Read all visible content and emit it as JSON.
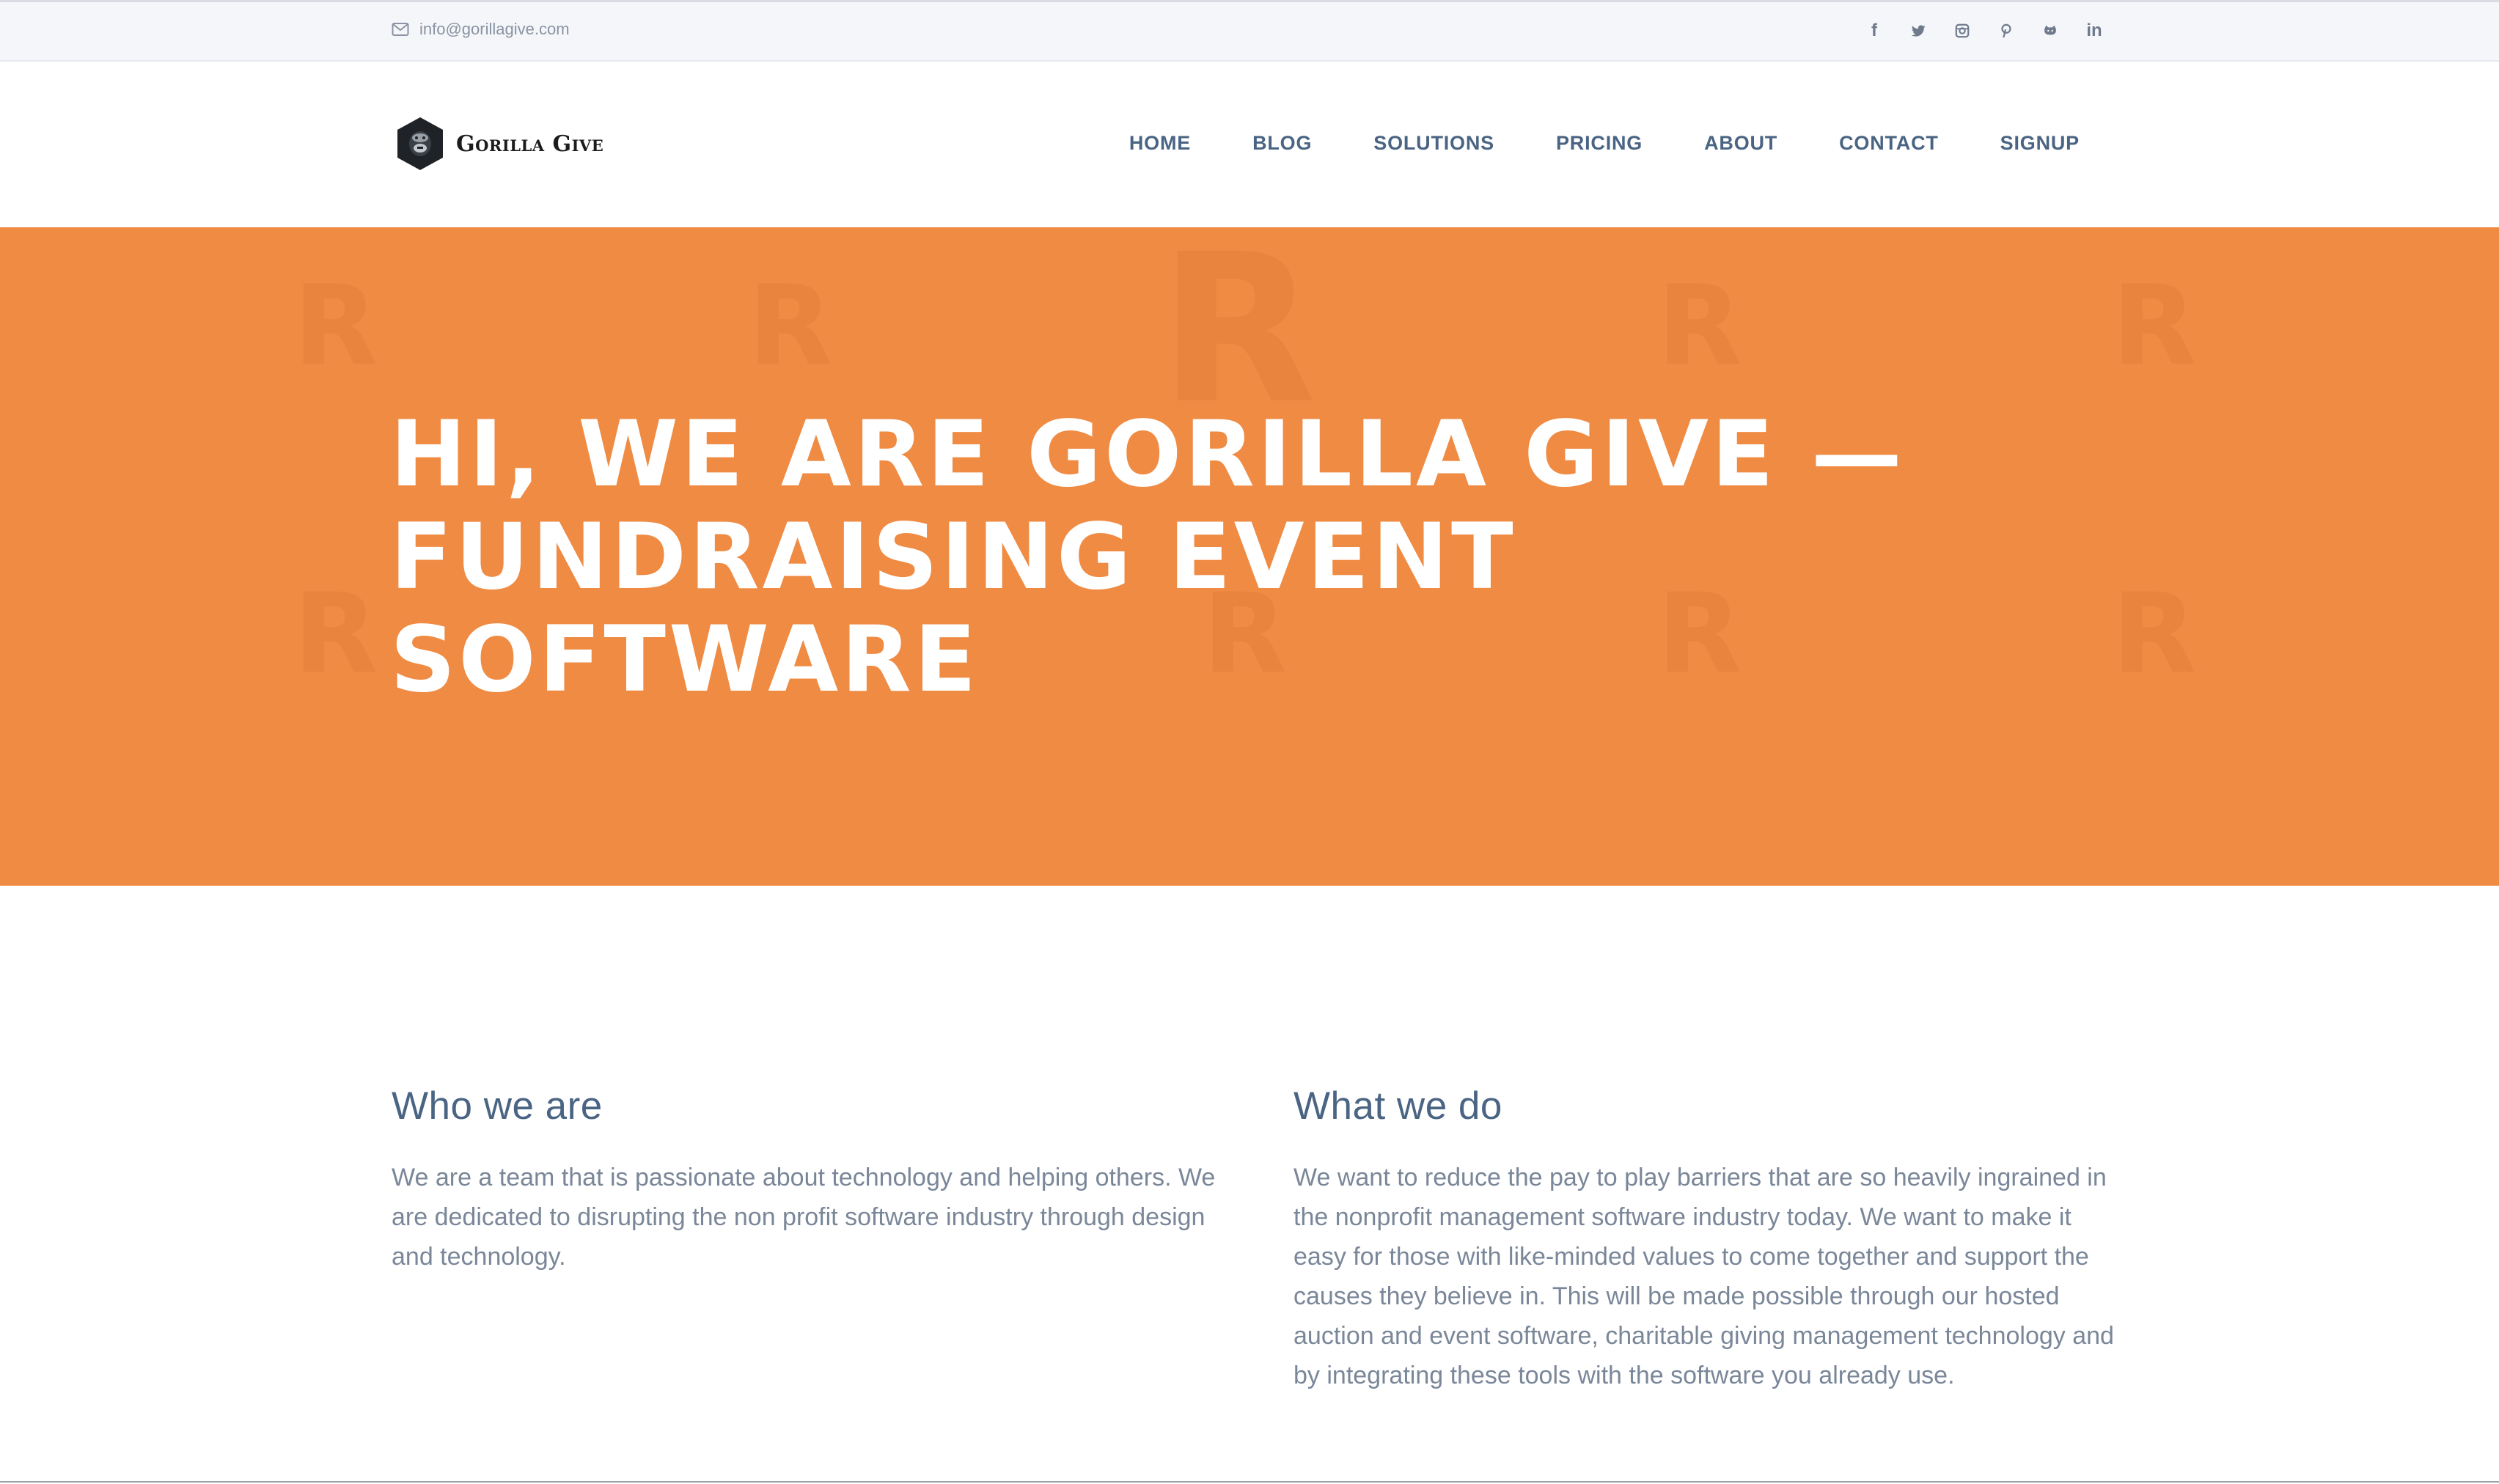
{
  "topbar": {
    "email": "info@gorillagive.com",
    "social_icons": [
      "facebook-icon",
      "twitter-icon",
      "instagram-icon",
      "pinterest-icon",
      "github-icon",
      "linkedin-icon"
    ]
  },
  "brand": {
    "name": "Gorilla Give"
  },
  "nav": {
    "items": [
      "HOME",
      "BLOG",
      "SOLUTIONS",
      "PRICING",
      "ABOUT",
      "CONTACT",
      "SIGNUP"
    ]
  },
  "hero": {
    "title": "HI, WE ARE GORILLA GIVE —\nFUNDRAISING EVENT\nSOFTWARE",
    "background_color": "#ef8b43"
  },
  "sections": {
    "who": {
      "heading": "Who we are",
      "body": "We are a team that is passionate about technology and helping others. We are dedicated to disrupting the non profit software industry through design and technology."
    },
    "what": {
      "heading": "What we do",
      "body": "We want to reduce the pay to play barriers that are so heavily ingrained in the nonprofit management software industry today. We want to make it easy for those with like-minded values to come together and support the causes they believe in. This will be made possible through our hosted auction and event software, charitable giving management technology and by integrating these tools with the software you already use."
    }
  },
  "colors": {
    "accent": "#ef8b43",
    "nav_text": "#4a6483",
    "body_text": "#7a8799"
  }
}
